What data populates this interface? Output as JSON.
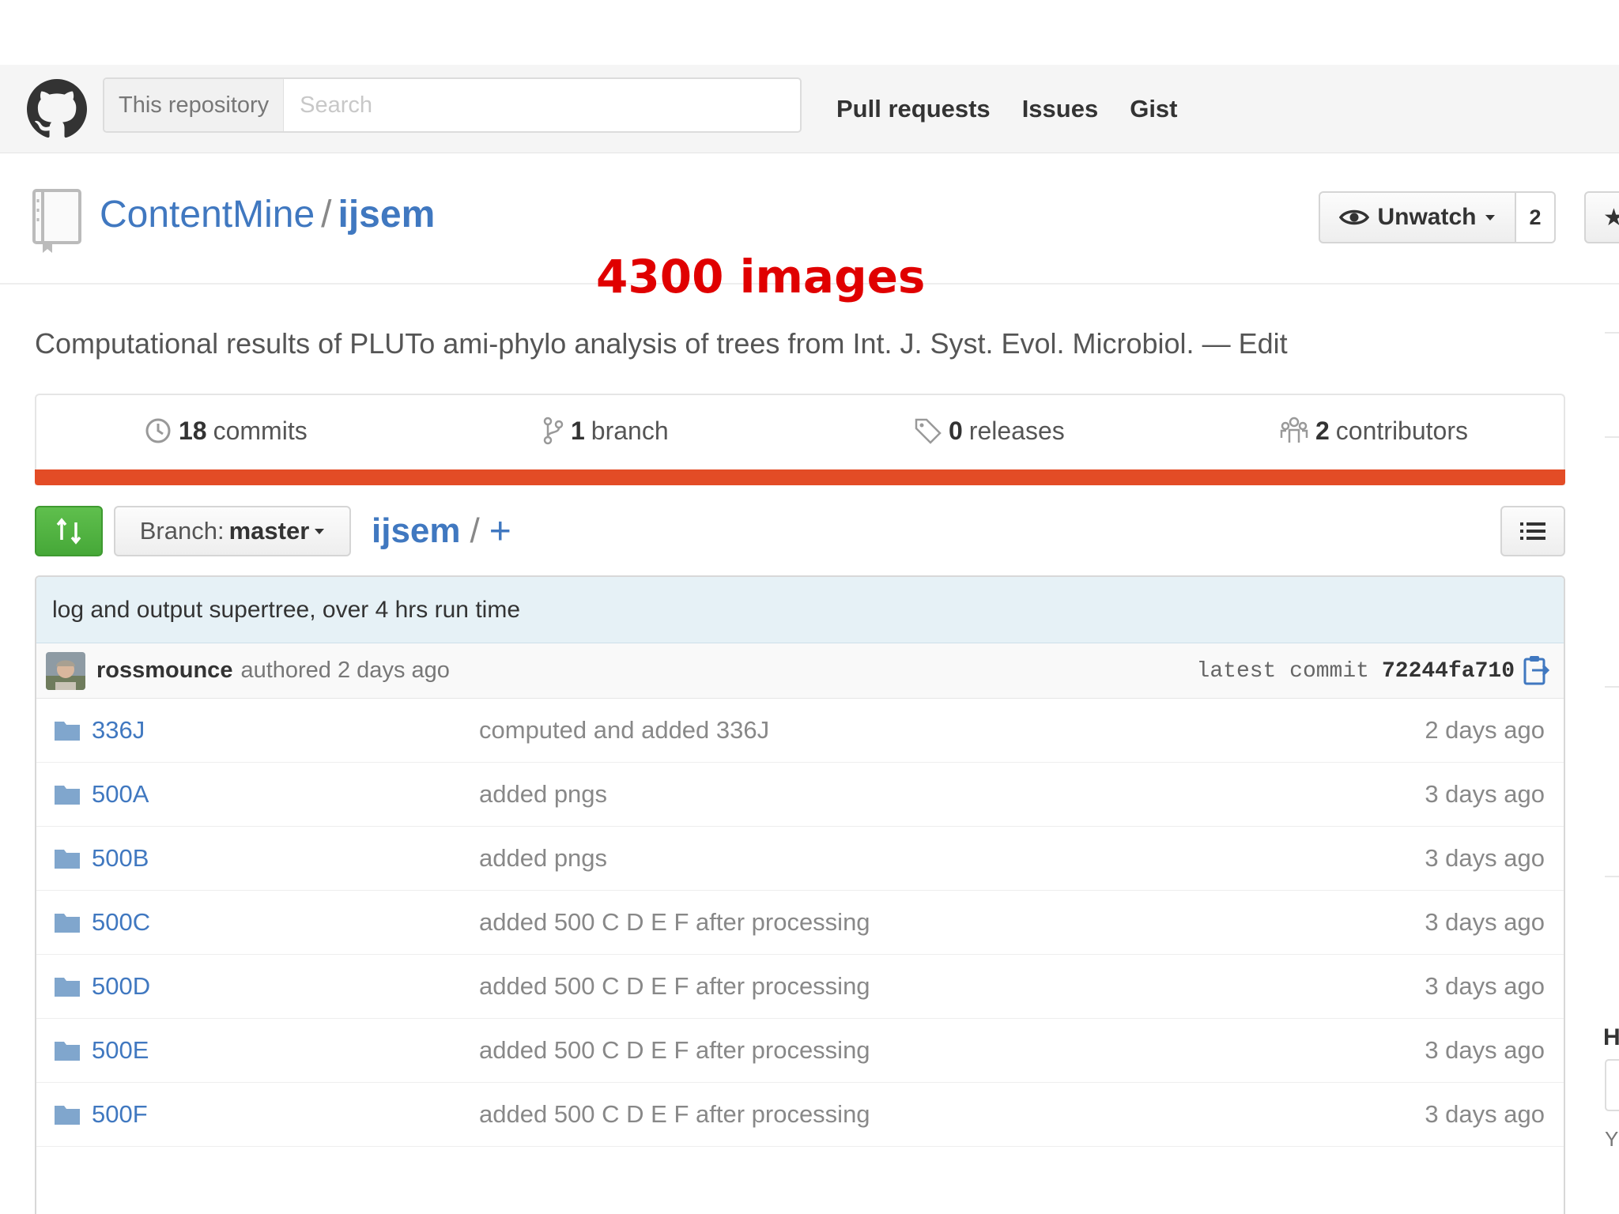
{
  "header": {
    "search_scope": "This repository",
    "search_placeholder": "Search",
    "nav": [
      "Pull requests",
      "Issues",
      "Gist"
    ]
  },
  "repo": {
    "owner": "ContentMine",
    "separator": "/",
    "name": "ijsem",
    "watch_label": "Unwatch",
    "watch_count": "2",
    "star_glyph": "★"
  },
  "annotation": "4300 images",
  "description": "Computational results of PLUTo ami-phylo analysis of trees from Int. J. Syst. Evol. Microbiol. — Edit",
  "summary": {
    "commits": {
      "count": "18",
      "label": "commits"
    },
    "branches": {
      "count": "1",
      "label": "branch"
    },
    "releases": {
      "count": "0",
      "label": "releases"
    },
    "contributors": {
      "count": "2",
      "label": "contributors"
    }
  },
  "colors": {
    "link": "#4078c0",
    "language_bar": "#e34c26",
    "compare_button": "#55b347",
    "annotation": "#e00000"
  },
  "file_nav": {
    "branch_prefix": "Branch:",
    "branch_name": "master",
    "path_root": "ijsem",
    "path_sep": "/",
    "path_add": "+"
  },
  "commit": {
    "message": "log and output supertree, over 4 hrs run time",
    "author": "rossmounce",
    "authored": "authored 2 days ago",
    "sha_label": "latest commit",
    "sha": "72244fa710"
  },
  "files": [
    {
      "name": "336J",
      "message": "computed and added 336J",
      "age": "2 days ago"
    },
    {
      "name": "500A",
      "message": "added pngs",
      "age": "3 days ago"
    },
    {
      "name": "500B",
      "message": "added pngs",
      "age": "3 days ago"
    },
    {
      "name": "500C",
      "message": "added 500 C D E F after processing",
      "age": "3 days ago"
    },
    {
      "name": "500D",
      "message": "added 500 C D E F after processing",
      "age": "3 days ago"
    },
    {
      "name": "500E",
      "message": "added 500 C D E F after processing",
      "age": "3 days ago"
    },
    {
      "name": "500F",
      "message": "added 500 C D E F after processing",
      "age": "3 days ago"
    }
  ],
  "edge": {
    "heading_fragment": "H",
    "text_fragment": "Y"
  }
}
